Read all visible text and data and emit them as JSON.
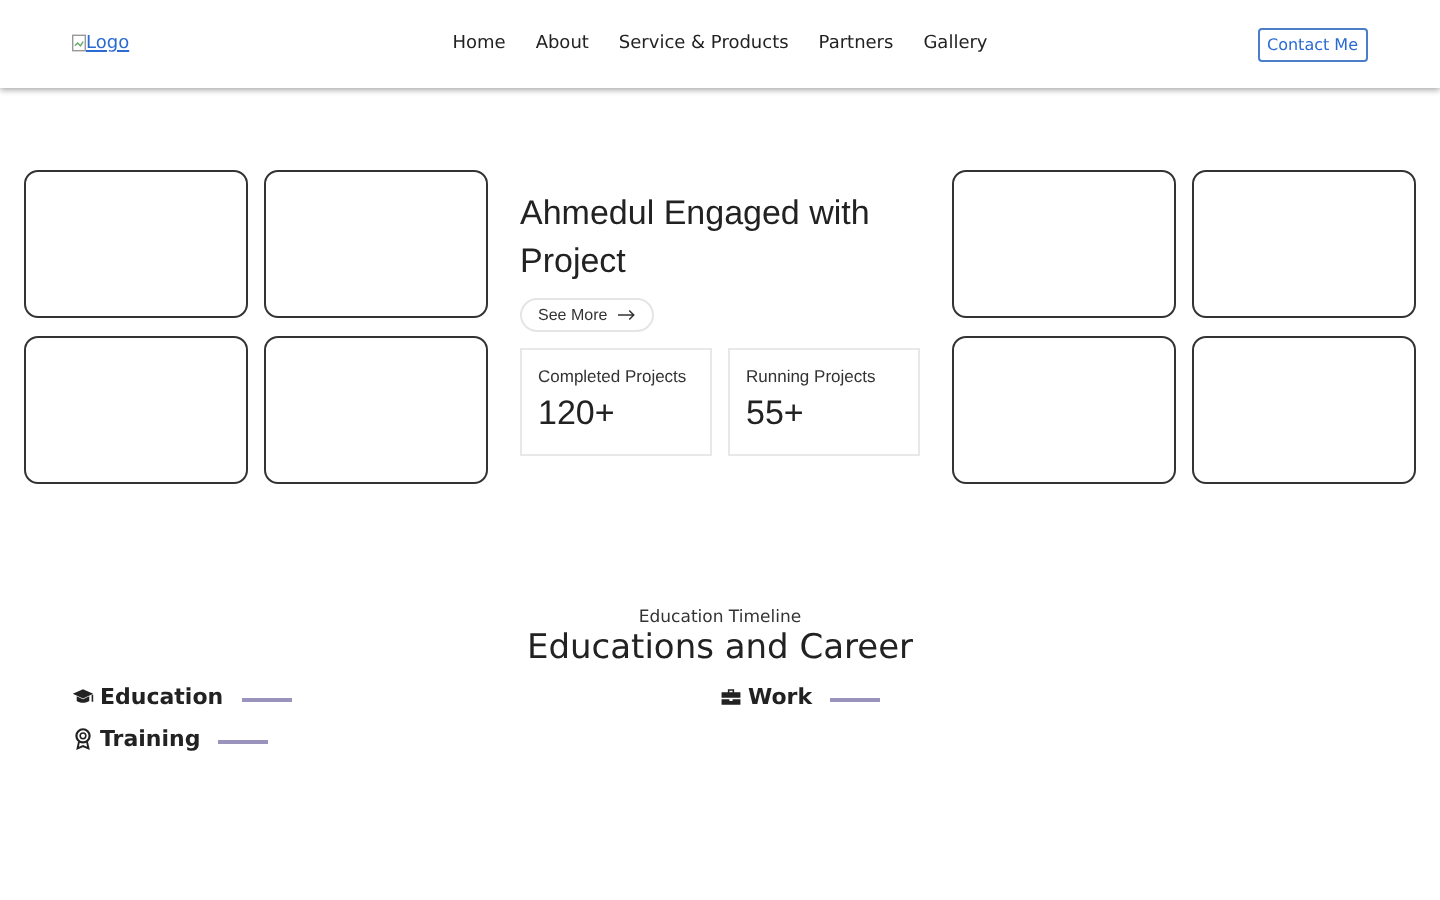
{
  "header": {
    "logo": "Logo",
    "nav": [
      {
        "label": "Home"
      },
      {
        "label": "About"
      },
      {
        "label": "Service & Products"
      },
      {
        "label": "Partners"
      },
      {
        "label": "Gallery"
      }
    ],
    "contact_button": "Contact Me"
  },
  "hero": {
    "title": "Ahmedul Engaged with Project",
    "see_more": "See More",
    "stats": [
      {
        "label": "Completed Projects",
        "value": "120+"
      },
      {
        "label": "Running Projects",
        "value": "55+"
      }
    ]
  },
  "timeline": {
    "eyebrow": "Education Timeline",
    "title": "Educations and Career",
    "columns": [
      {
        "items": [
          {
            "kind": "education",
            "label": "Education"
          },
          {
            "kind": "training",
            "label": "Training"
          }
        ]
      },
      {
        "items": [
          {
            "kind": "work",
            "label": "Work"
          }
        ]
      }
    ]
  }
}
